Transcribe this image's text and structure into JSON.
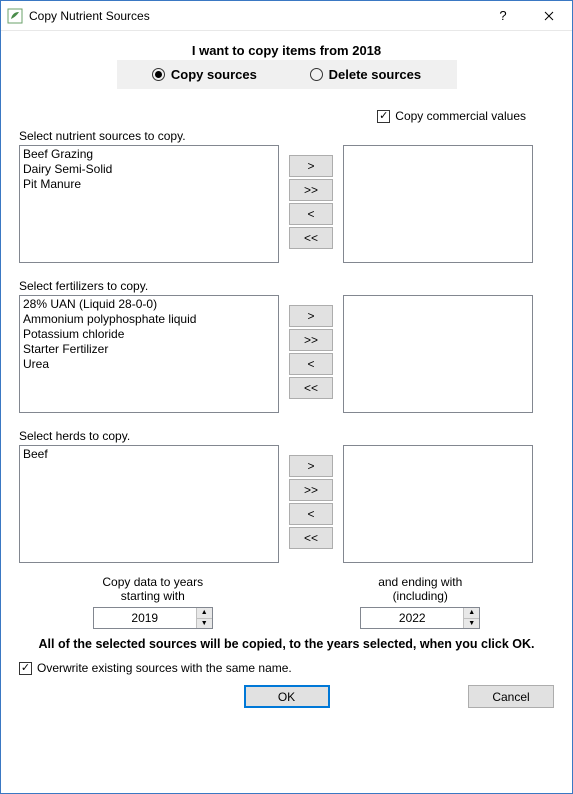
{
  "window": {
    "title": "Copy Nutrient Sources"
  },
  "header": {
    "heading": "I want to copy items from 2018",
    "radios": {
      "copy_label": "Copy sources",
      "delete_label": "Delete sources"
    }
  },
  "copy_commercial": {
    "label": "Copy commercial values"
  },
  "sections": {
    "nutrient": {
      "label": "Select nutrient sources to copy.",
      "left": [
        "Beef Grazing",
        "Dairy Semi-Solid",
        "Pit Manure"
      ]
    },
    "fertilizers": {
      "label": "Select fertilizers to copy.",
      "left": [
        "28% UAN (Liquid 28-0-0)",
        "Ammonium polyphosphate liquid",
        "Potassium chloride",
        "Starter Fertilizer",
        "Urea"
      ]
    },
    "herds": {
      "label": "Select herds to copy.",
      "left": [
        "Beef"
      ]
    }
  },
  "move_buttons": {
    "add": ">",
    "add_all": ">>",
    "remove": "<",
    "remove_all": "<<"
  },
  "years": {
    "start_label1": "Copy data to years",
    "start_label2": "starting with",
    "start_value": "2019",
    "end_label1": "and ending with",
    "end_label2": "(including)",
    "end_value": "2022"
  },
  "note": "All of the selected sources will be copied, to the years selected, when you click OK.",
  "overwrite": {
    "label": "Overwrite existing sources with the same name."
  },
  "buttons": {
    "ok": "OK",
    "cancel": "Cancel"
  }
}
